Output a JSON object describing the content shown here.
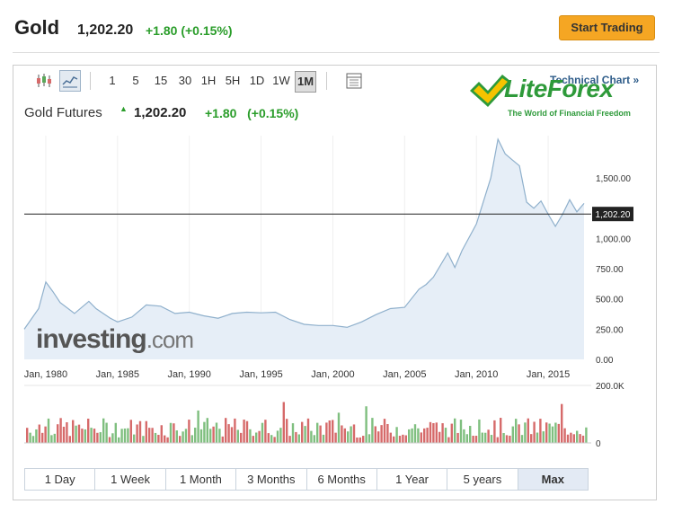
{
  "header": {
    "title": "Gold",
    "price": "1,202.20",
    "change": "+1.80 (+0.15%)",
    "start_button": "Start Trading"
  },
  "toolbar": {
    "intervals": [
      "1",
      "5",
      "15",
      "30",
      "1H",
      "5H",
      "1D",
      "1W",
      "1M"
    ],
    "selected_interval": "1M",
    "technical_chart": "Technical Chart »"
  },
  "logo": {
    "name": "LiteForex",
    "tagline": "The World of Financial Freedom"
  },
  "legend": {
    "name": "Gold Futures",
    "price": "1,202.20",
    "change": "+1.80",
    "change_pct": "(+0.15%)"
  },
  "watermark": {
    "brand": "investing",
    "domain": ".com"
  },
  "range_buttons": [
    "1 Day",
    "1 Week",
    "1 Month",
    "3 Months",
    "6 Months",
    "1 Year",
    "5 years",
    "Max"
  ],
  "selected_range": "Max",
  "colors": {
    "up": "#2a9d2a",
    "accent_button": "#f5a623",
    "line": "#8fb0cc",
    "area": "#e6eef7",
    "volume_up": "#7fbf7f",
    "volume_down": "#d66a6a"
  },
  "chart_data": {
    "type": "area",
    "title": "Gold Futures",
    "x_tick_labels": [
      "Jan, 1980",
      "Jan, 1985",
      "Jan, 1990",
      "Jan, 1995",
      "Jan, 2000",
      "Jan, 2005",
      "Jan, 2010",
      "Jan, 2015"
    ],
    "y_tick_labels": [
      "0.00",
      "250.00",
      "500.00",
      "750.00",
      "1,000.00",
      "1,500.00"
    ],
    "ylim": [
      0,
      1850
    ],
    "current_price_line": 1202.2,
    "current_price_label": "1,202.20",
    "series": [
      {
        "x": [
          1978.5,
          1979.5,
          1980.0,
          1980.5,
          1981.0,
          1982.0,
          1983.0,
          1983.5,
          1984.5,
          1985.0,
          1986.0,
          1987.0,
          1988.0,
          1989.0,
          1990.0,
          1991.0,
          1992.0,
          1993.0,
          1994.0,
          1995.0,
          1996.0,
          1997.0,
          1998.0,
          1999.0,
          2000.0,
          2001.0,
          2002.0,
          2003.0,
          2004.0,
          2005.0,
          2006.0,
          2006.5,
          2007.0,
          2008.0,
          2008.5,
          2009.0,
          2010.0,
          2011.0,
          2011.5,
          2012.0,
          2012.5,
          2013.0,
          2013.5,
          2014.0,
          2014.5,
          2015.0,
          2015.5,
          2016.0,
          2016.5,
          2017.0,
          2017.5
        ],
        "values": [
          250,
          420,
          640,
          560,
          470,
          380,
          480,
          420,
          340,
          310,
          350,
          450,
          440,
          380,
          390,
          360,
          340,
          380,
          390,
          385,
          390,
          330,
          290,
          280,
          280,
          265,
          310,
          370,
          420,
          430,
          580,
          620,
          680,
          880,
          760,
          900,
          1120,
          1500,
          1820,
          1700,
          1650,
          1600,
          1300,
          1250,
          1310,
          1200,
          1100,
          1200,
          1320,
          1220,
          1290
        ]
      }
    ],
    "volume_axis_labels": [
      "200.0K",
      "0"
    ]
  }
}
